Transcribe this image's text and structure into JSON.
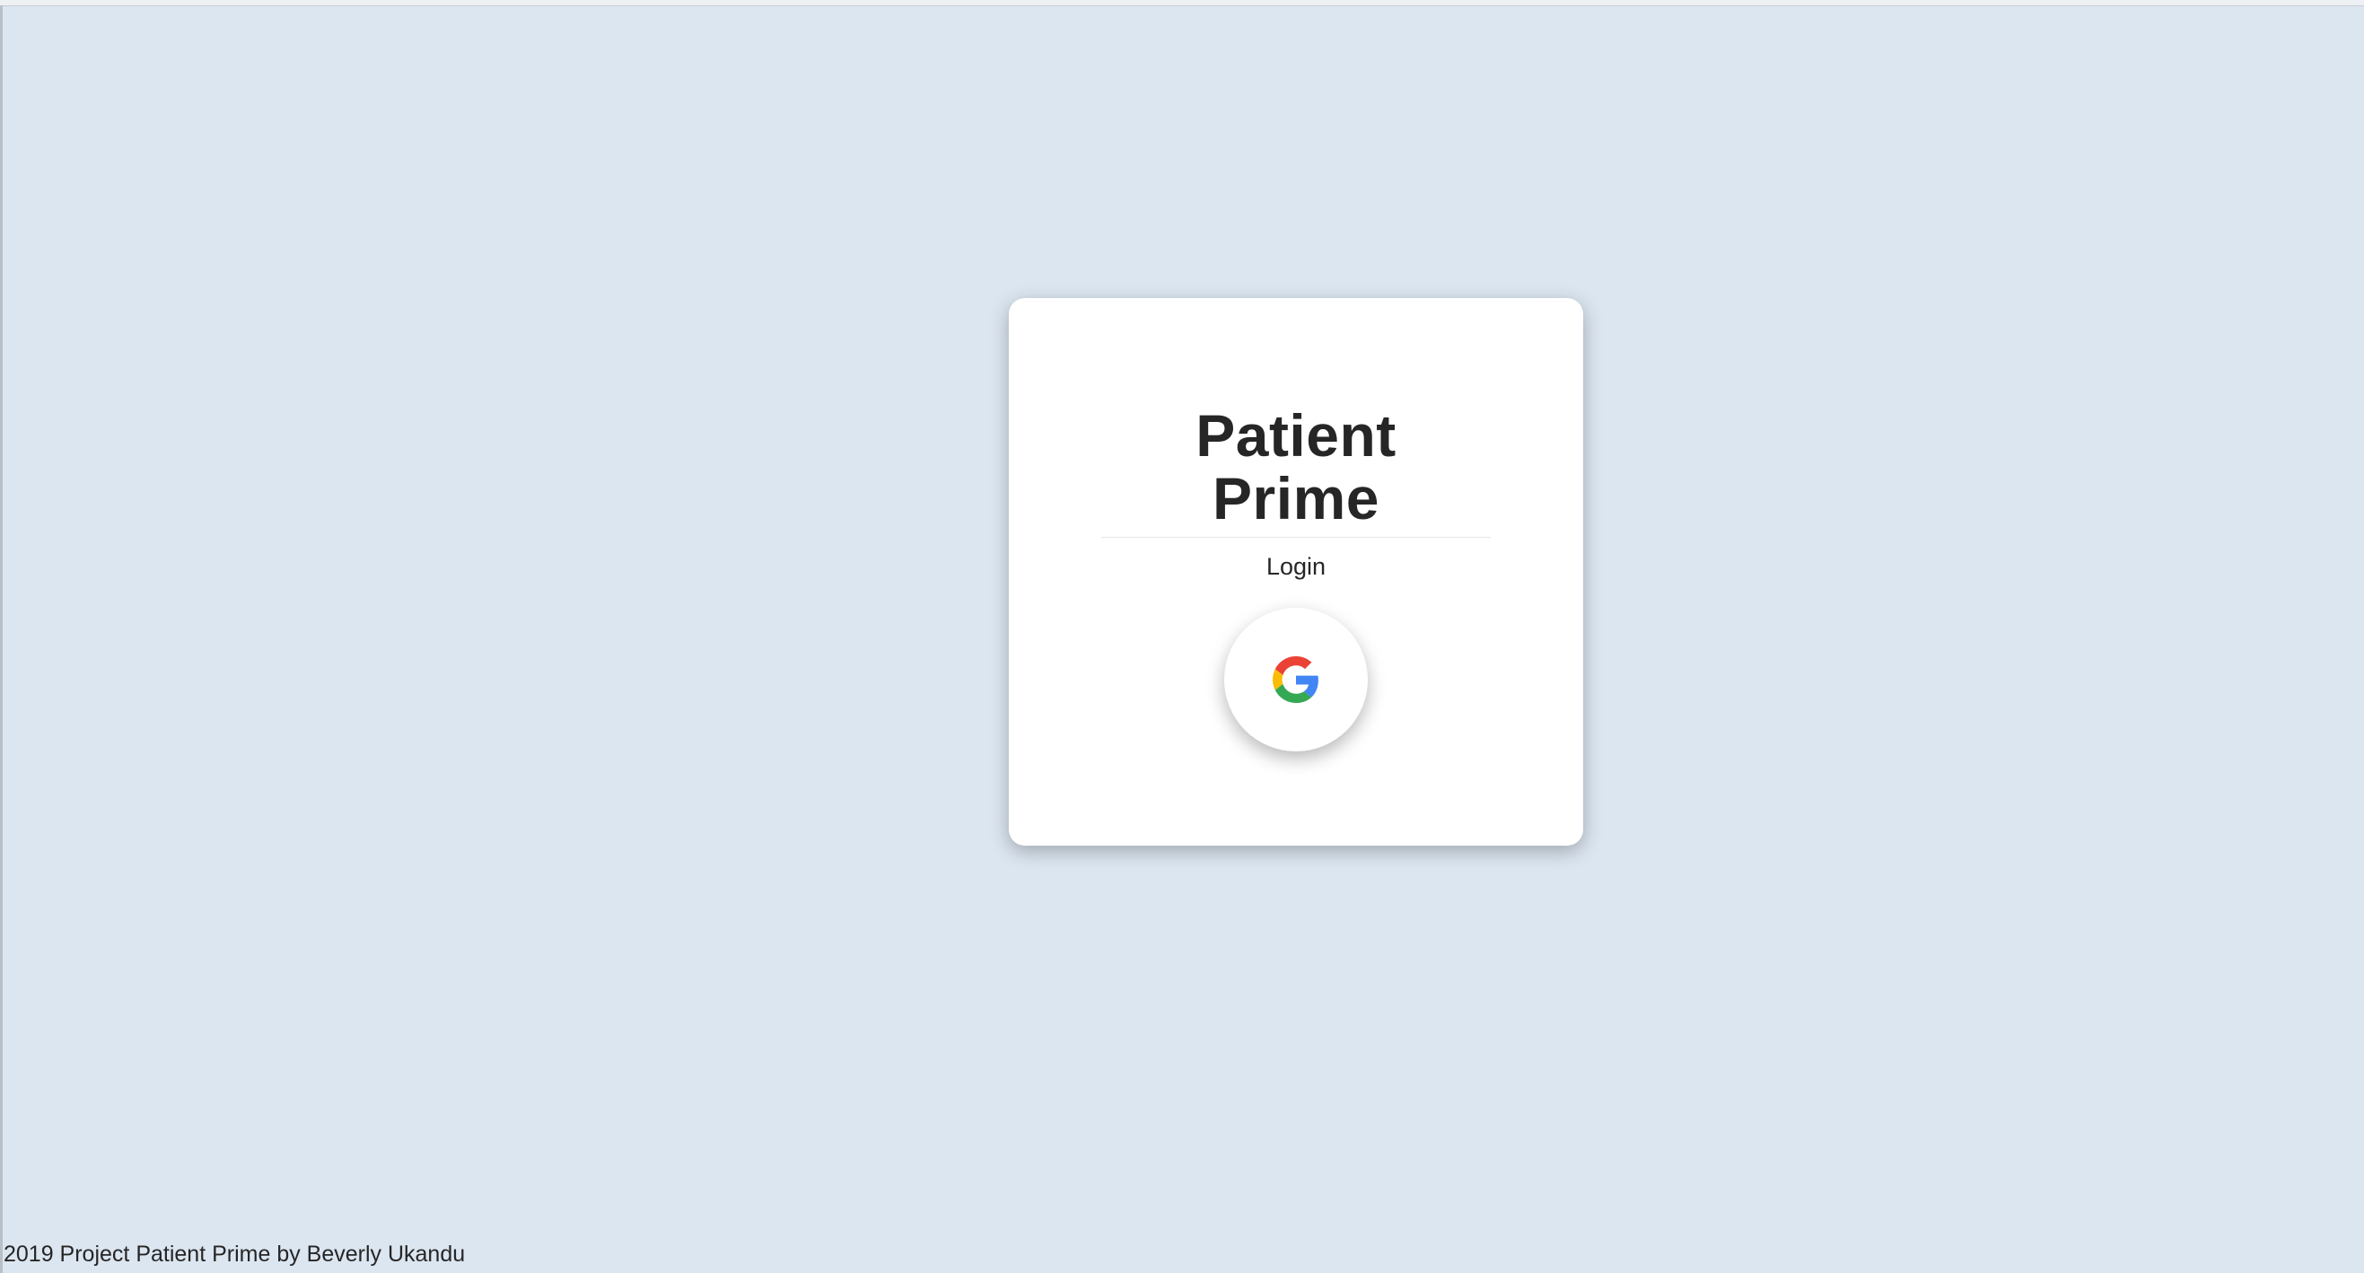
{
  "app": {
    "title_line1": "Patient",
    "title_line2": "Prime"
  },
  "login": {
    "label": "Login",
    "google_button_icon": "google-g-icon",
    "icon_colors": {
      "blue": "#4285F4",
      "green": "#34A853",
      "yellow": "#FBBC05",
      "red": "#EA4335"
    }
  },
  "footer": {
    "text": "2019 Project Patient Prime by Beverly Ukandu"
  },
  "colors": {
    "background": "#dce6f1",
    "card": "#ffffff",
    "text": "#262626"
  }
}
